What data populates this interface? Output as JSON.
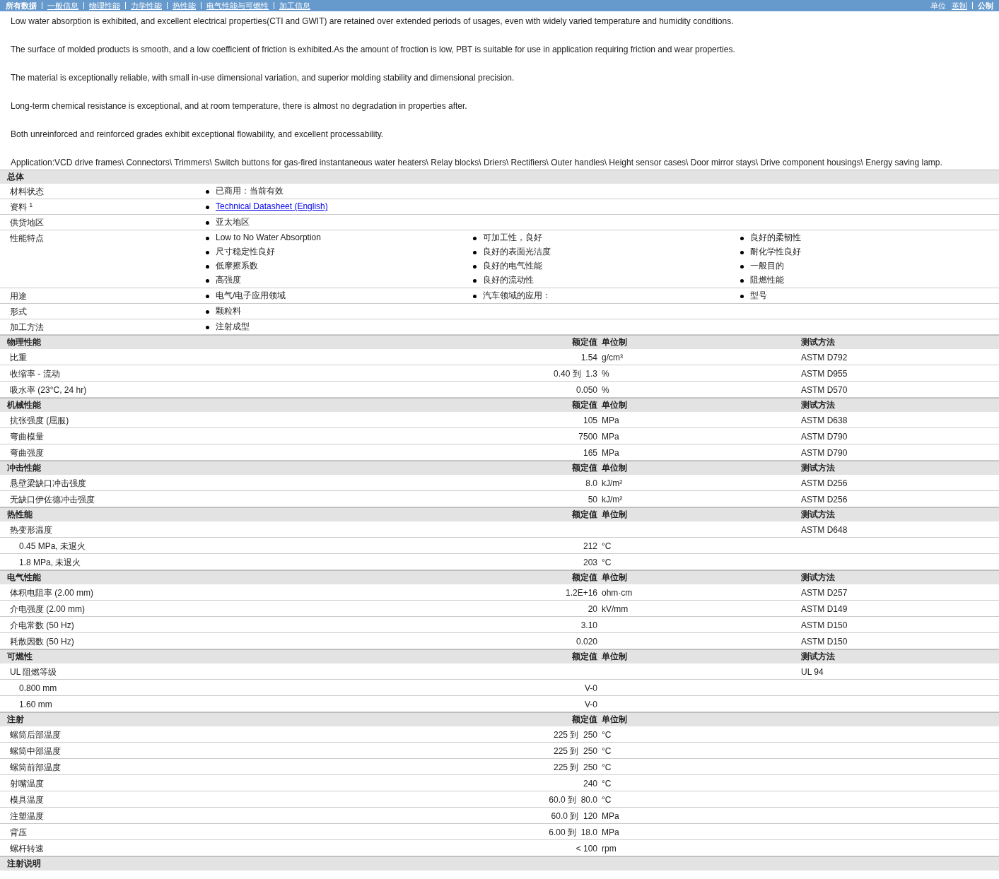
{
  "top_nav": {
    "tabs": [
      {
        "label": "所有数据",
        "selected": true
      },
      {
        "label": "一般信息",
        "selected": false
      },
      {
        "label": "物理性能",
        "selected": false
      },
      {
        "label": "力学性能",
        "selected": false
      },
      {
        "label": "热性能",
        "selected": false
      },
      {
        "label": "电气性能与可燃性",
        "selected": false
      },
      {
        "label": "加工信息",
        "selected": false
      }
    ],
    "units": {
      "label": "单位",
      "options": [
        {
          "label": "英制",
          "selected": false
        },
        {
          "label": "公制",
          "selected": true
        }
      ]
    }
  },
  "intro_paragraphs": [
    "Low water absorption is exhibited, and excellent electrical properties(CTI and GWIT) are retained over extended periods of usages, even with widely varied temperature and humidity conditions.",
    "The surface of molded products is smooth, and a low coefficient of friction is exhibited.As the amount of froction is low, PBT is suitable for use in application requiring friction and wear properties.",
    "The material is exceptionally reliable, with small in-use dimensional variation, and superior molding stability and dimensional precision.",
    "Long-term chemical resistance is exceptional, and at room temperature, there is almost no degradation in properties after.",
    "Both unreinforced and reinforced grades exhibit exceptional flowability, and excellent processability.",
    "Application:VCD drive frames\\ Connectors\\ Trimmers\\ Switch buttons for gas-fired instantaneous water heaters\\ Relay blocks\\ Driers\\ Rectifiers\\ Outer handles\\ Height sensor cases\\ Door mirror stays\\ Drive component housings\\ Energy saving lamp."
  ],
  "general": {
    "title": "总体",
    "rows": [
      {
        "label": "材料状态",
        "columns": [
          [
            {
              "kind": "text",
              "text": "已商用：当前有效"
            }
          ]
        ]
      },
      {
        "label": "资料 $^{1}$",
        "columns": [
          [
            {
              "kind": "link",
              "text": "Technical Datasheet (English)"
            }
          ]
        ]
      },
      {
        "label": "供货地区",
        "columns": [
          [
            {
              "kind": "text",
              "text": "亚太地区"
            }
          ]
        ]
      },
      {
        "label": "性能特点",
        "columns": [
          [
            {
              "kind": "text",
              "text": "Low to No Water Absorption"
            },
            {
              "kind": "text",
              "text": "尺寸稳定性良好"
            },
            {
              "kind": "text",
              "text": "低摩擦系数"
            },
            {
              "kind": "text",
              "text": "高强度"
            }
          ],
          [
            {
              "kind": "text",
              "text": "可加工性，良好"
            },
            {
              "kind": "text",
              "text": "良好的表面光洁度"
            },
            {
              "kind": "text",
              "text": "良好的电气性能"
            },
            {
              "kind": "text",
              "text": "良好的流动性"
            }
          ],
          [
            {
              "kind": "text",
              "text": "良好的柔韧性"
            },
            {
              "kind": "text",
              "text": "耐化学性良好"
            },
            {
              "kind": "text",
              "text": "一般目的"
            },
            {
              "kind": "text",
              "text": "阻燃性能"
            }
          ]
        ]
      },
      {
        "label": "用途",
        "columns": [
          [
            {
              "kind": "text",
              "text": "电气/电子应用领域"
            }
          ],
          [
            {
              "kind": "text",
              "text": "汽车领域的应用："
            }
          ],
          [
            {
              "kind": "text",
              "text": "型号"
            }
          ]
        ]
      },
      {
        "label": "形式",
        "columns": [
          [
            {
              "kind": "text",
              "text": "颗粒料"
            }
          ]
        ]
      },
      {
        "label": "加工方法",
        "columns": [
          [
            {
              "kind": "text",
              "text": "注射成型"
            }
          ]
        ]
      }
    ]
  },
  "property_sections": [
    {
      "title": "物理性能",
      "header": {
        "value": "额定值",
        "unit": "单位制",
        "method": "测试方法"
      },
      "rows": [
        {
          "label": "比重",
          "value": "1.54",
          "unit": "g/cm³",
          "method": "ASTM D792"
        },
        {
          "label": "收缩率 - 流动",
          "value": "0.40 到  1.3",
          "unit": "%",
          "method": "ASTM D955"
        },
        {
          "label": "吸水率 (23°C, 24 hr)",
          "value": "0.050",
          "unit": "%",
          "method": "ASTM D570"
        }
      ]
    },
    {
      "title": "机械性能",
      "header": {
        "value": "额定值",
        "unit": "单位制",
        "method": "测试方法"
      },
      "rows": [
        {
          "label": "抗张强度 (屈服)",
          "value": "105",
          "unit": "MPa",
          "method": "ASTM D638"
        },
        {
          "label": "弯曲模量",
          "value": "7500",
          "unit": "MPa",
          "method": "ASTM D790"
        },
        {
          "label": "弯曲强度",
          "value": "165",
          "unit": "MPa",
          "method": "ASTM D790"
        }
      ]
    },
    {
      "title": "冲击性能",
      "header": {
        "value": "额定值",
        "unit": "单位制",
        "method": "测试方法"
      },
      "rows": [
        {
          "label": "悬壁梁缺口冲击强度",
          "value": "8.0",
          "unit": "kJ/m²",
          "method": "ASTM D256"
        },
        {
          "label": "无缺口伊佐德冲击强度",
          "value": "50",
          "unit": "kJ/m²",
          "method": "ASTM D256"
        }
      ]
    },
    {
      "title": "热性能",
      "header": {
        "value": "额定值",
        "unit": "单位制",
        "method": "测试方法"
      },
      "rows": [
        {
          "label": "热变形温度",
          "method": "ASTM D648",
          "children": [
            {
              "label": "0.45 MPa, 未退火",
              "value": "212",
              "unit": "°C"
            },
            {
              "label": "1.8 MPa, 未退火",
              "value": "203",
              "unit": "°C"
            }
          ]
        }
      ]
    },
    {
      "title": "电气性能",
      "header": {
        "value": "额定值",
        "unit": "单位制",
        "method": "测试方法"
      },
      "rows": [
        {
          "label": "体积电阻率 (2.00 mm)",
          "value": "1.2E+16",
          "unit": "ohm·cm",
          "method": "ASTM D257"
        },
        {
          "label": "介电强度 (2.00 mm)",
          "value": "20",
          "unit": "kV/mm",
          "method": "ASTM D149"
        },
        {
          "label": "介电常数 (50 Hz)",
          "value": "3.10",
          "method": "ASTM D150"
        },
        {
          "label": "耗散因数 (50 Hz)",
          "value": "0.020",
          "method": "ASTM D150"
        }
      ]
    },
    {
      "title": "可燃性",
      "header": {
        "value": "额定值",
        "unit": "单位制",
        "method": "测试方法"
      },
      "rows": [
        {
          "label": "UL 阻燃等级",
          "method": "UL 94",
          "children": [
            {
              "label": "0.800 mm",
              "value": "V-0"
            },
            {
              "label": "1.60 mm",
              "value": "V-0"
            }
          ]
        }
      ]
    },
    {
      "title": "注射",
      "header": {
        "value": "额定值",
        "unit": "单位制"
      },
      "rows": [
        {
          "label": "螺筒后部温度",
          "value": "225 到  250",
          "unit": "°C"
        },
        {
          "label": "螺筒中部温度",
          "value": "225 到  250",
          "unit": "°C"
        },
        {
          "label": "螺筒前部温度",
          "value": "225 到  250",
          "unit": "°C"
        },
        {
          "label": "射嘴温度",
          "value": "240",
          "unit": "°C"
        },
        {
          "label": "模具温度",
          "value": "60.0 到  80.0",
          "unit": "°C"
        },
        {
          "label": "注塑温度",
          "value": "60.0 到  120",
          "unit": "MPa"
        },
        {
          "label": "背压",
          "value": "6.00 到  18.0",
          "unit": "MPa"
        },
        {
          "label": "螺杆转速",
          "value": "< 100",
          "unit": "rpm"
        }
      ]
    },
    {
      "title": "注射说明"
    }
  ]
}
